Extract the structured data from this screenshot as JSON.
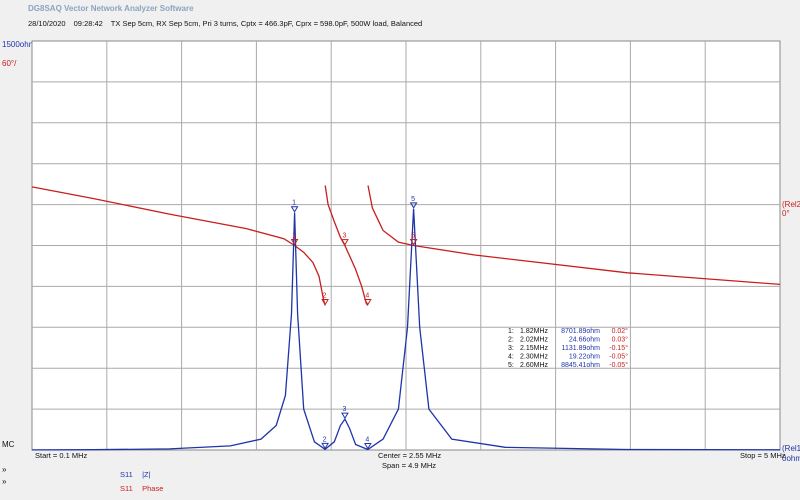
{
  "window": {
    "app_title": "DG8SAQ Vector Network Analyzer Software",
    "date": "28/10/2020",
    "time": "09:28:42",
    "description": "TX Sep 5cm, RX Sep 5cm, Pri 3 turns, Cptx = 466.3pF, Cprx = 598.0pF, 500W load, Balanced"
  },
  "scales": {
    "left_top_blue": "1500ohm/",
    "left_top_red": "60°/",
    "left_bottom": "MC",
    "left_bottom2": "»",
    "left_bottom3": "»",
    "right_mid_red_1": "(Rel2",
    "right_mid_red_2": "0°",
    "right_bottom_1": "(Rel1",
    "right_bottom_2": "0ohm"
  },
  "footer": {
    "start": "Start = 0.1 MHz",
    "center": "Center = 2.55 MHz",
    "span": "Span = 4.9 MHz",
    "stop": "Stop = 5 MHz"
  },
  "legend": [
    {
      "trace": "S11",
      "name": "|Z|",
      "color": "#1f34a8"
    },
    {
      "trace": "S11",
      "name": "Phase",
      "color": "#c81e1e"
    }
  ],
  "colors": {
    "blue": "#1f34a8",
    "red": "#c81e1e",
    "grid": "#aaaaaa",
    "plot_bg": "#ffffff",
    "page_bg": "#f0f0f0"
  },
  "markers": [
    {
      "id": "1",
      "freq": "1.82MHz",
      "imp": "8701.89ohm",
      "phase": "0.02°"
    },
    {
      "id": "2",
      "freq": "2.02MHz",
      "imp": "24.66ohm",
      "phase": "0.03°"
    },
    {
      "id": "3",
      "freq": "2.15MHz",
      "imp": "1131.89ohm",
      "phase": "-0.15°"
    },
    {
      "id": "4",
      "freq": "2.30MHz",
      "imp": "19.22ohm",
      "phase": "-0.05°"
    },
    {
      "id": "5",
      "freq": "2.60MHz",
      "imp": "8845.41ohm",
      "phase": "-0.05°"
    }
  ],
  "chart_data": {
    "type": "line",
    "x_range_mhz": [
      0.1,
      5.0
    ],
    "grid": true,
    "x_divisions": 10,
    "y_divisions": 10,
    "series": [
      {
        "name": "|Z|",
        "unit": "ohm",
        "ylim": [
          0,
          15000
        ],
        "x": [
          0.1,
          0.5,
          1.0,
          1.4,
          1.6,
          1.7,
          1.76,
          1.8,
          1.82,
          1.84,
          1.88,
          1.95,
          2.02,
          2.08,
          2.12,
          2.15,
          2.18,
          2.22,
          2.3,
          2.4,
          2.5,
          2.56,
          2.6,
          2.64,
          2.7,
          2.85,
          3.2,
          4.0,
          5.0
        ],
        "values": [
          2,
          10,
          40,
          150,
          400,
          900,
          2000,
          5000,
          8701.89,
          5000,
          1500,
          300,
          24.66,
          300,
          900,
          1131.89,
          800,
          200,
          19.22,
          400,
          1500,
          4500,
          8845.41,
          4500,
          1500,
          400,
          100,
          20,
          8
        ]
      },
      {
        "name": "Phase",
        "unit": "deg",
        "ylim": [
          -300,
          300
        ],
        "x": [
          0.1,
          0.5,
          1.0,
          1.5,
          1.75,
          1.82,
          1.88,
          1.94,
          1.98,
          2.01,
          2.02,
          2.021,
          2.04,
          2.08,
          2.12,
          2.15,
          2.18,
          2.22,
          2.26,
          2.29,
          2.3,
          2.301,
          2.33,
          2.4,
          2.5,
          2.6,
          3.0,
          4.0,
          5.0
        ],
        "values": [
          86,
          69,
          46,
          25,
          10,
          0.02,
          -10,
          -25,
          -45,
          -80,
          -88,
          88,
          60,
          35,
          12,
          -0.15,
          -15,
          -35,
          -60,
          -85,
          -88,
          88,
          55,
          22,
          5,
          -0.05,
          -14,
          -40,
          -57
        ]
      }
    ]
  }
}
